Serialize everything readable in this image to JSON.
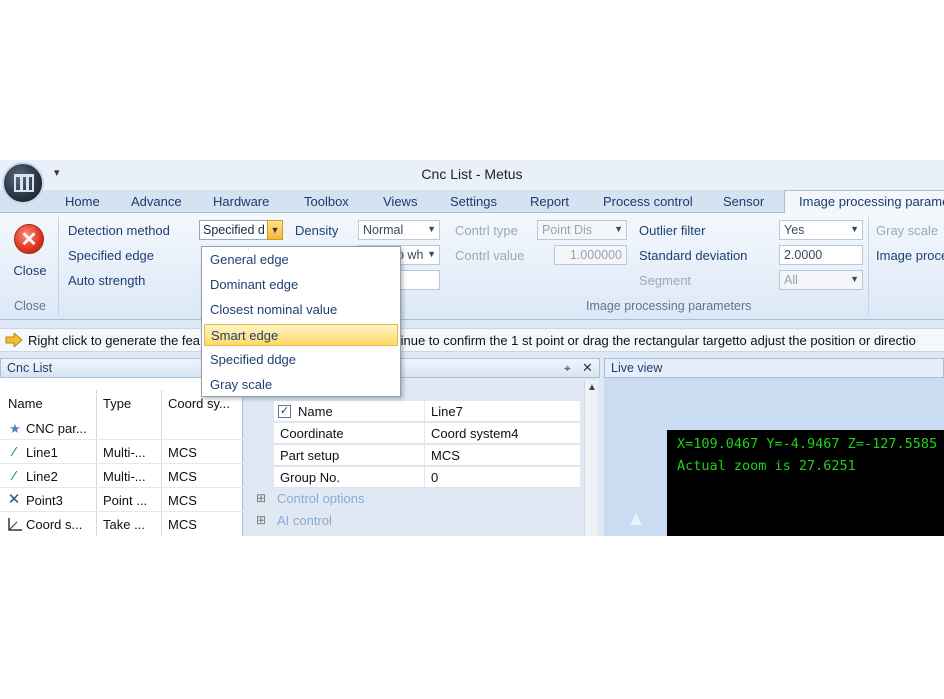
{
  "window": {
    "title": "Cnc List - Metus",
    "quick_access_arrow": "▾"
  },
  "tabs": [
    {
      "label": "Home",
      "active": false
    },
    {
      "label": "Advance",
      "active": false
    },
    {
      "label": "Hardware",
      "active": false
    },
    {
      "label": "Toolbox",
      "active": false
    },
    {
      "label": "Views",
      "active": false
    },
    {
      "label": "Settings",
      "active": false
    },
    {
      "label": "Report",
      "active": false
    },
    {
      "label": "Process control",
      "active": false
    },
    {
      "label": "Sensor",
      "active": false
    },
    {
      "label": "Image processing parame",
      "active": true
    }
  ],
  "ribbon": {
    "close": {
      "label": "Close",
      "icon": "close-icon",
      "group_label": "Close"
    },
    "detection_method_label": "Detection method",
    "detection_method_value": "Specified d",
    "specified_edge_label": "Specified edge",
    "auto_strength_label": "Auto strength",
    "density_label": "Density",
    "density_value": "Normal",
    "specified_edge_value": "o wh",
    "contrl_type_label": "Contrl type",
    "contrl_type_value": "Point Dis",
    "contrl_value_label": "Contrl value",
    "contrl_value_value": "1.000000",
    "outlier_filter_label": "Outlier filter",
    "outlier_filter_value": "Yes",
    "standard_deviation_label": "Standard deviation",
    "standard_deviation_value": "2.0000",
    "segment_label": "Segment",
    "segment_value": "All",
    "gray_scale_label": "Gray scale",
    "image_proc_label": "Image proce",
    "group_label": "Image processing parameters"
  },
  "dropdown": {
    "items": [
      {
        "label": "General edge",
        "highlighted": false
      },
      {
        "label": "Dominant edge",
        "highlighted": false
      },
      {
        "label": "Closest nominal value",
        "highlighted": false
      },
      {
        "label": "Smart edge",
        "highlighted": true
      },
      {
        "label": "Specified ddge",
        "highlighted": false
      },
      {
        "label": "Gray scale",
        "highlighted": false
      }
    ]
  },
  "hint": {
    "text_left": "Right click to generate the fea",
    "text_right": "tinue to confirm the 1 st point or drag the rectangular targetto adjust the position or directio"
  },
  "cnc_list": {
    "title": "Cnc List",
    "columns": [
      "Name",
      "Type",
      "Coord sy..."
    ],
    "rows": [
      {
        "icon": "star-icon",
        "name": "CNC par...",
        "type": "",
        "coord": ""
      },
      {
        "icon": "line-icon",
        "name": "Line1",
        "type": "Multi-...",
        "coord": "MCS"
      },
      {
        "icon": "line-icon",
        "name": "Line2",
        "type": "Multi-...",
        "coord": "MCS"
      },
      {
        "icon": "point-icon",
        "name": "Point3",
        "type": "Point ...",
        "coord": "MCS"
      },
      {
        "icon": "coord-system-icon",
        "name": "Coord s...",
        "type": "Take ...",
        "coord": "MCS"
      }
    ]
  },
  "properties": {
    "pin_icon": "pin-icon",
    "close_icon": "close-icon",
    "rows": [
      {
        "label": "Name",
        "value": "Line7",
        "checked": true
      },
      {
        "label": "Coordinate",
        "value": "Coord system4"
      },
      {
        "label": "Part setup",
        "value": "MCS"
      },
      {
        "label": "Group No.",
        "value": "0"
      }
    ],
    "groups": [
      "Control options",
      "AI control"
    ],
    "check_mark": "✓",
    "expander": "⊞"
  },
  "live_view": {
    "title": "Live view",
    "coordinates": "X=109.0467 Y=-4.9467 Z=-127.5585",
    "zoom": "Actual zoom is 27.6251"
  },
  "colors": {
    "accent": "#f5b93a",
    "ribbon": "#dce8f6",
    "live_text": "#1fd01f"
  }
}
